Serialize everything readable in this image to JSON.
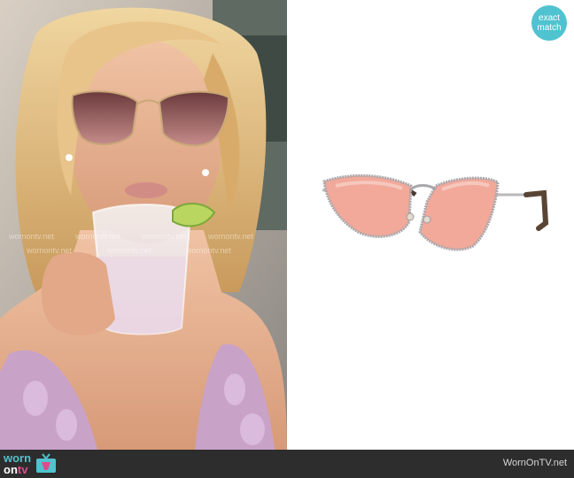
{
  "badge": {
    "line1": "exact",
    "line2": "match"
  },
  "watermark": {
    "text": "wornontv.net"
  },
  "footer": {
    "logo_worn": "worn",
    "logo_on": "on",
    "logo_tv": "tv",
    "site": "WornOnTV.net"
  },
  "colors": {
    "badge": "#4fc3cf",
    "footer_bg": "#2d2d2d",
    "lens": "#f2a99a",
    "logo_pink": "#e14b8a"
  },
  "icons": [
    "tv-icon"
  ]
}
